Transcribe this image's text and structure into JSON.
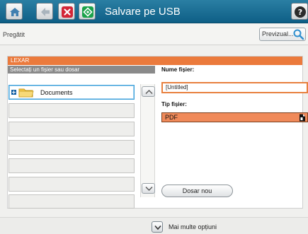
{
  "topbar": {
    "title": "Salvare pe USB",
    "home_icon": "home-icon",
    "back_icon": "back-arrow-icon",
    "stop_icon": "stop-icon",
    "start_icon": "start-icon",
    "help_icon": "help-icon"
  },
  "status": {
    "text": "Pregătit",
    "preview_label": "Previzual...",
    "preview_icon": "magnifier-icon"
  },
  "drive": {
    "name": "LEXAR"
  },
  "file_list": {
    "header": "Selectați un fișier sau dosar",
    "items": [
      {
        "label": "Documents",
        "icon": "folder-icon",
        "expand_icon": "expand-plus-icon",
        "selected": true
      }
    ],
    "empty_rows": 6
  },
  "file_name": {
    "label": "Nume fișier:",
    "value": "[Untitled]"
  },
  "file_type": {
    "label": "Tip fișier:",
    "value": "PDF"
  },
  "new_folder": {
    "label": "Dosar nou"
  },
  "more_options": {
    "label": "Mai multe opțiuni",
    "icon": "chevron-down-icon"
  },
  "colors": {
    "topbar": "#1f7aa0",
    "drive_header": "#eb7a3c",
    "selection": "#3a9fd8",
    "input_border": "#e8803f",
    "select_fill": "#f08a5a"
  }
}
